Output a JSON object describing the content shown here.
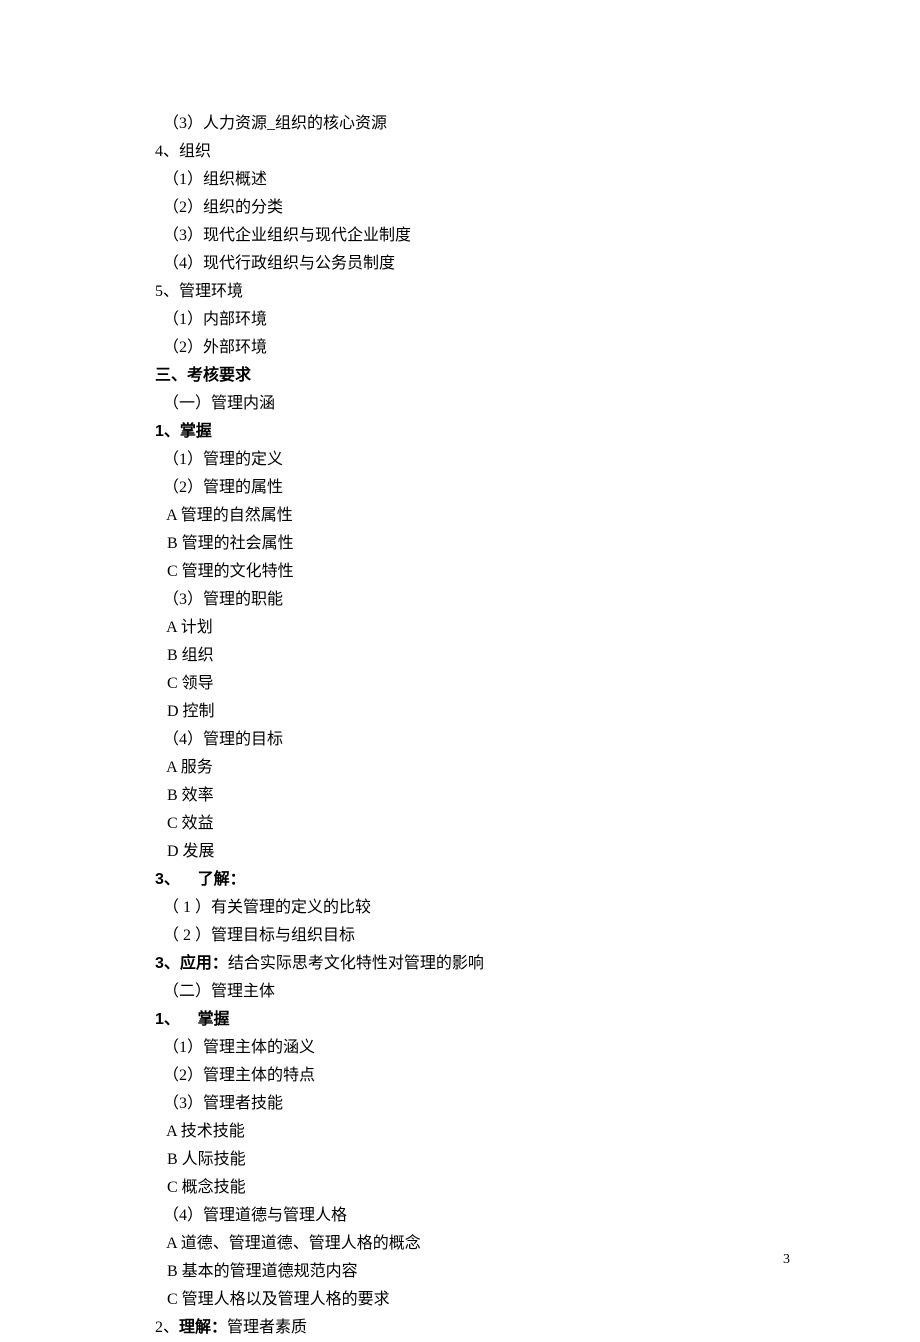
{
  "lines": [
    {
      "text": "（3）人力资源_组织的核心资源",
      "cls": "indent"
    },
    {
      "text": "4、组织",
      "cls": ""
    },
    {
      "text": "（1）组织概述",
      "cls": "indent"
    },
    {
      "text": "（2）组织的分类",
      "cls": "indent"
    },
    {
      "text": "（3）现代企业组织与现代企业制度",
      "cls": "indent"
    },
    {
      "text": "（4）现代行政组织与公务员制度",
      "cls": "indent"
    },
    {
      "text": "5、管理环境",
      "cls": ""
    },
    {
      "text": "（1）内部环境",
      "cls": "indent"
    },
    {
      "text": "（2）外部环境",
      "cls": "indent"
    },
    {
      "text": "三、考核要求",
      "cls": "bold"
    },
    {
      "text": "（一）管理内涵",
      "cls": "indent"
    },
    {
      "text": "1、掌握",
      "cls": "bold"
    },
    {
      "text": "（1）管理的定义",
      "cls": "indent"
    },
    {
      "text": "（2）管理的属性",
      "cls": "indent"
    },
    {
      "text": " A 管理的自然属性",
      "cls": "indent"
    },
    {
      "text": " B 管理的社会属性",
      "cls": "indent"
    },
    {
      "text": " C 管理的文化特性",
      "cls": "indent"
    },
    {
      "text": "（3）管理的职能",
      "cls": "indent"
    },
    {
      "text": " A 计划",
      "cls": "indent"
    },
    {
      "text": " B 组织",
      "cls": "indent"
    },
    {
      "text": " C 领导",
      "cls": "indent"
    },
    {
      "text": " D 控制",
      "cls": "indent"
    },
    {
      "text": "（4）管理的目标",
      "cls": "indent"
    },
    {
      "text": " A 服务",
      "cls": "indent"
    },
    {
      "text": " B 效率",
      "cls": "indent"
    },
    {
      "text": " C 效益",
      "cls": "indent"
    },
    {
      "text": " D 发展",
      "cls": "indent"
    },
    {
      "text": "3、    了解：",
      "cls": "bold"
    },
    {
      "text": "（ 1 ）有关管理的定义的比较",
      "cls": "indent"
    },
    {
      "text": "（ 2 ）管理目标与组织目标",
      "cls": "indent"
    },
    {
      "runs": [
        {
          "t": "3、应用：",
          "b": true
        },
        {
          "t": "结合实际思考文化特性对管理的影响",
          "b": false
        }
      ],
      "cls": ""
    },
    {
      "text": "（二）管理主体",
      "cls": "indent"
    },
    {
      "text": "1、    掌握",
      "cls": "bold"
    },
    {
      "text": "（1）管理主体的涵义",
      "cls": "indent"
    },
    {
      "text": "（2）管理主体的特点",
      "cls": "indent"
    },
    {
      "text": "（3）管理者技能",
      "cls": "indent"
    },
    {
      "text": " A 技术技能",
      "cls": "indent"
    },
    {
      "text": " B 人际技能",
      "cls": "indent"
    },
    {
      "text": " C 概念技能",
      "cls": "indent"
    },
    {
      "text": "（4）管理道德与管理人格",
      "cls": "indent"
    },
    {
      "text": " A 道德、管理道德、管理人格的概念",
      "cls": "indent"
    },
    {
      "text": " B 基本的管理道德规范内容",
      "cls": "indent"
    },
    {
      "text": " C 管理人格以及管理人格的要求",
      "cls": "indent"
    },
    {
      "runs": [
        {
          "t": "2、",
          "b": false
        },
        {
          "t": "理解：",
          "b": true
        },
        {
          "t": "管理者素质",
          "b": false
        }
      ],
      "cls": ""
    }
  ],
  "page_number": "3"
}
